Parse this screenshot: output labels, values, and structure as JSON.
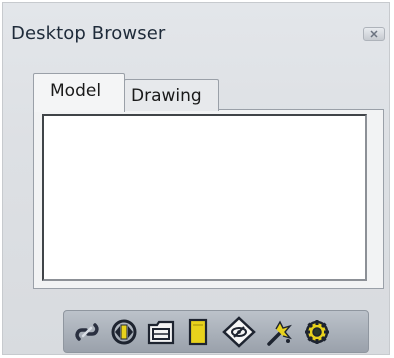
{
  "window": {
    "title": "Desktop Browser"
  },
  "tabs": [
    {
      "label": "Model",
      "active": true
    },
    {
      "label": "Drawing",
      "active": false
    }
  ],
  "toolbar": {
    "icons": [
      "link-icon",
      "update-icon",
      "folder-icon",
      "document-icon",
      "view-icon",
      "wand-icon",
      "gear-icon"
    ]
  },
  "colors": {
    "panel_background": "#dde0e4",
    "toolbar_background": "#a9b0b9",
    "icon_yellow": "#e8d21c"
  }
}
